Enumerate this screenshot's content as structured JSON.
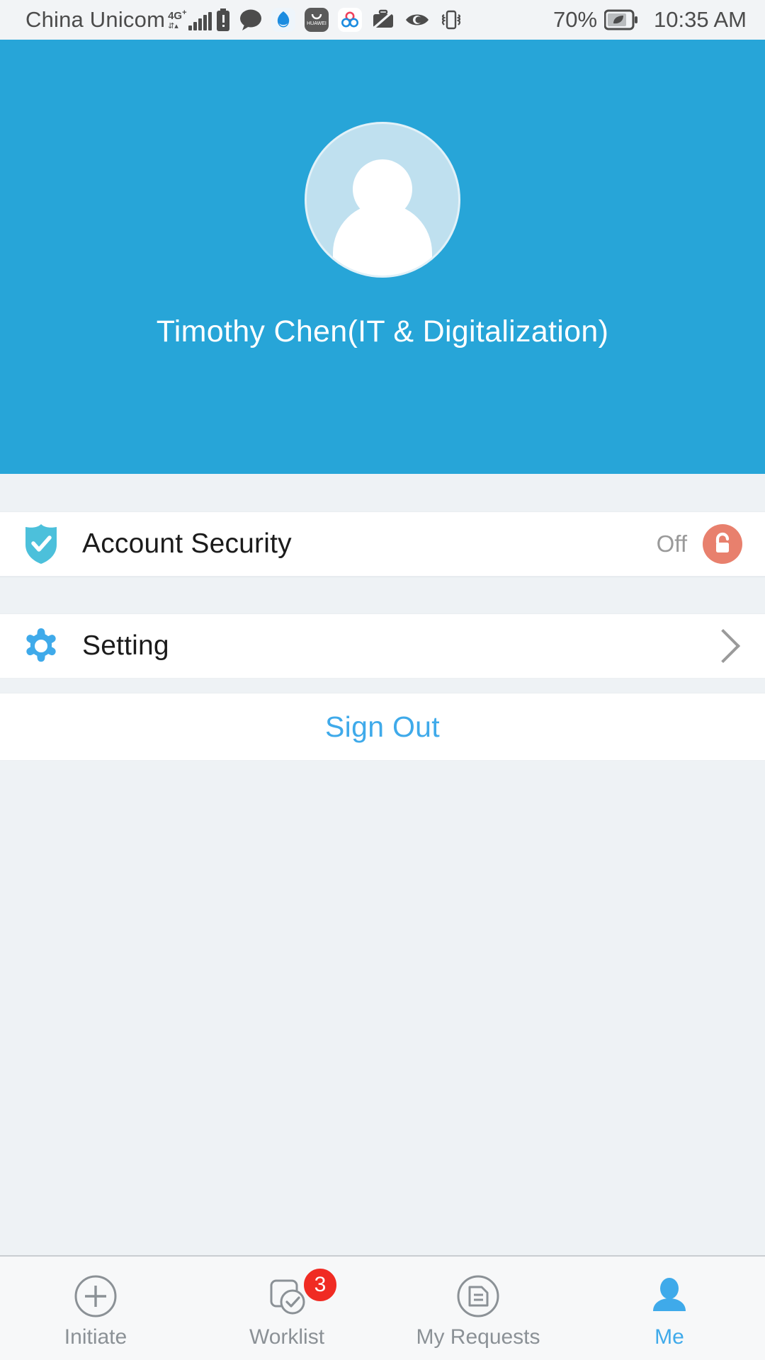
{
  "statusbar": {
    "carrier": "China Unicom",
    "network": "4G",
    "network_sup": "+",
    "battery_percent": "70%",
    "time": "10:35 AM",
    "icons": [
      "signal-bars-icon",
      "battery-alert-icon",
      "chat-bubble-icon",
      "cloud-browser-app-icon",
      "huawei-app-icon",
      "colorful-app-icon",
      "work-mode-off-icon",
      "eye-comfort-icon",
      "vibrate-icon",
      "battery-saver-leaf-icon"
    ]
  },
  "header": {
    "avatar_icon": "default-user-avatar",
    "user_name": "Timothy Chen(IT & Digitalization)",
    "background_color": "#27a5d8"
  },
  "list": {
    "account_security": {
      "icon": "shield-check-icon",
      "icon_color": "#4cc0db",
      "label": "Account Security",
      "value": "Off",
      "status_icon": "unlocked-padlock-icon",
      "status_color": "#e8806d"
    },
    "setting": {
      "icon": "gear-icon",
      "icon_color": "#3faaea",
      "label": "Setting",
      "chevron_icon": "chevron-right-icon"
    },
    "sign_out": {
      "label": "Sign Out",
      "color": "#3faaea"
    }
  },
  "tabbar": {
    "items": [
      {
        "label": "Initiate",
        "icon": "plus-circle-icon",
        "active": false,
        "badge": ""
      },
      {
        "label": "Worklist",
        "icon": "task-check-icon",
        "active": false,
        "badge": "3"
      },
      {
        "label": "My Requests",
        "icon": "document-circle-icon",
        "active": false,
        "badge": ""
      },
      {
        "label": "Me",
        "icon": "person-filled-icon",
        "active": true,
        "badge": ""
      }
    ],
    "active_color": "#3faaea",
    "inactive_color": "#8b9196",
    "badge_color": "#f02b23"
  }
}
